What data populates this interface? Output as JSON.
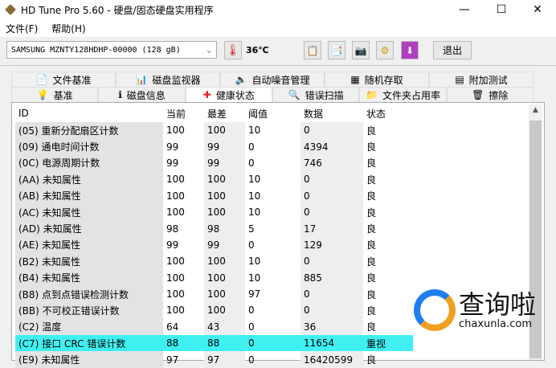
{
  "window": {
    "title": "HD Tune Pro 5.60 - 硬盘/固态硬盘实用程序",
    "minimize": "—",
    "maximize": "☐",
    "close": "✕"
  },
  "menu": [
    "文件(F)",
    "帮助(H)"
  ],
  "toolbar": {
    "drive": "SAMSUNG MZNTY128HDHP-00000 (128 gB)",
    "temperature": "36℃",
    "exit": "退出"
  },
  "tabs_top": [
    {
      "label": "文件基准",
      "icon": "file-benchmark-icon",
      "glyph": "📄"
    },
    {
      "label": "磁盘监视器",
      "icon": "disk-monitor-icon",
      "glyph": "📊"
    },
    {
      "label": "自动噪音管理",
      "icon": "speaker-icon",
      "glyph": "🔈"
    },
    {
      "label": "随机存取",
      "icon": "random-access-icon",
      "glyph": "▦"
    },
    {
      "label": "附加测试",
      "icon": "extra-tests-icon",
      "glyph": "▤"
    }
  ],
  "tabs_bottom": [
    {
      "label": "基准",
      "icon": "benchmark-icon",
      "glyph": "💡"
    },
    {
      "label": "磁盘信息",
      "icon": "info-icon",
      "glyph": "ℹ"
    },
    {
      "label": "健康状态",
      "icon": "health-cross-icon",
      "glyph": "✚"
    },
    {
      "label": "错误扫描",
      "icon": "magnifier-icon",
      "glyph": "🔍"
    },
    {
      "label": "文件夹占用率",
      "icon": "folder-icon",
      "glyph": "📁"
    },
    {
      "label": "擦除",
      "icon": "trash-icon",
      "glyph": "🗑"
    }
  ],
  "table": {
    "headers": [
      "ID",
      "当前",
      "最差",
      "阈值",
      "数据",
      "状态"
    ],
    "rows": [
      [
        "(05) 重新分配扇区计数",
        "100",
        "100",
        "10",
        "0",
        "良"
      ],
      [
        "(09) 通电时间计数",
        "99",
        "99",
        "0",
        "4394",
        "良"
      ],
      [
        "(0C) 电源周期计数",
        "99",
        "99",
        "0",
        "746",
        "良"
      ],
      [
        "(AA) 未知属性",
        "100",
        "100",
        "10",
        "0",
        "良"
      ],
      [
        "(AB) 未知属性",
        "100",
        "100",
        "10",
        "0",
        "良"
      ],
      [
        "(AC) 未知属性",
        "100",
        "100",
        "10",
        "0",
        "良"
      ],
      [
        "(AD) 未知属性",
        "98",
        "98",
        "5",
        "17",
        "良"
      ],
      [
        "(AE) 未知属性",
        "99",
        "99",
        "0",
        "129",
        "良"
      ],
      [
        "(B2) 未知属性",
        "100",
        "100",
        "10",
        "0",
        "良"
      ],
      [
        "(B4) 未知属性",
        "100",
        "100",
        "10",
        "885",
        "良"
      ],
      [
        "(B8) 点到点错误检测计数",
        "100",
        "100",
        "97",
        "0",
        "良"
      ],
      [
        "(BB) 不可校正错误计数",
        "100",
        "100",
        "0",
        "0",
        "良"
      ],
      [
        "(C2) 温度",
        "64",
        "43",
        "0",
        "36",
        "良"
      ],
      [
        "(C7) 接口 CRC 错误计数",
        "88",
        "88",
        "0",
        "11654",
        "重视"
      ],
      [
        "(E9) 未知属性",
        "97",
        "97",
        "0",
        "16420599",
        "良"
      ]
    ],
    "highlight_row": 13,
    "highlight_color": "#40f0f0"
  },
  "watermark": {
    "title": "查询啦",
    "url": "chaxunla.com"
  }
}
